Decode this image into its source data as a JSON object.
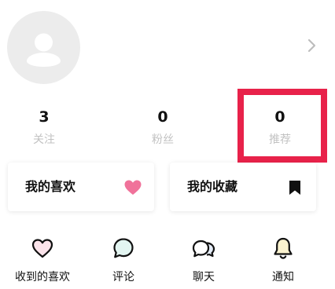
{
  "stats": [
    {
      "value": "3",
      "label": "关注"
    },
    {
      "value": "0",
      "label": "粉丝"
    },
    {
      "value": "0",
      "label": "推荐"
    }
  ],
  "cards": {
    "likes": {
      "label": "我的喜欢",
      "icon": "heart-icon"
    },
    "collect": {
      "label": "我的收藏",
      "icon": "bookmark-icon"
    }
  },
  "nav": [
    {
      "label": "收到的喜欢",
      "icon": "heart-outline-icon"
    },
    {
      "label": "评论",
      "icon": "comment-icon"
    },
    {
      "label": "聊天",
      "icon": "chat-icon"
    },
    {
      "label": "通知",
      "icon": "bell-icon"
    }
  ],
  "colors": {
    "highlight": "#e8224a",
    "heart": "#f0729a",
    "stat_label": "#c2c2c2",
    "avatar_bg": "#ececec"
  }
}
